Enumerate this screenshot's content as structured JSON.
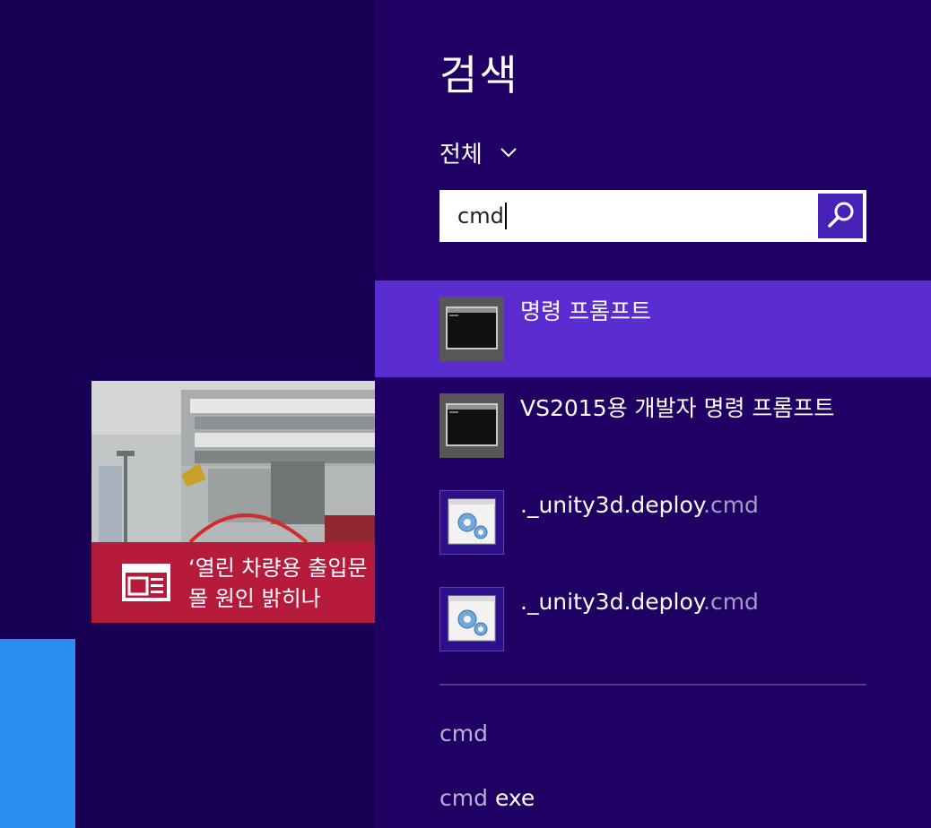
{
  "start_screen": {
    "news_tile": {
      "icon": "news-icon",
      "headline_line1": "‘열린 차량용 출입문",
      "headline_line2": "몰 원인 밝히나"
    }
  },
  "search_pane": {
    "title": "검색",
    "scope": {
      "label": "전체",
      "icon": "chevron-down-icon"
    },
    "search_box": {
      "value": "cmd",
      "button_icon": "search-icon"
    },
    "results": [
      {
        "name": "명령 프롬프트",
        "extension": "",
        "icon": "console-window-icon",
        "selected": true
      },
      {
        "name": "VS2015용 개발자 명령 프롬프트",
        "extension": "",
        "icon": "console-window-icon",
        "selected": false
      },
      {
        "name": "._unity3d.deploy",
        "extension": ".cmd",
        "icon": "gear-window-icon",
        "selected": false
      },
      {
        "name": "._unity3d.deploy",
        "extension": ".cmd",
        "icon": "gear-window-icon",
        "selected": false
      }
    ],
    "suggestions": [
      {
        "match": "cmd",
        "rest": ""
      },
      {
        "match": "cmd",
        "rest": "exe"
      }
    ]
  },
  "colors": {
    "background": "#180155",
    "pane_background": "#200062",
    "selected_result": "#5b2cd0",
    "search_button": "#4822b7",
    "news_band": "#b61b3c",
    "blue_tile": "#2a8ef0"
  }
}
